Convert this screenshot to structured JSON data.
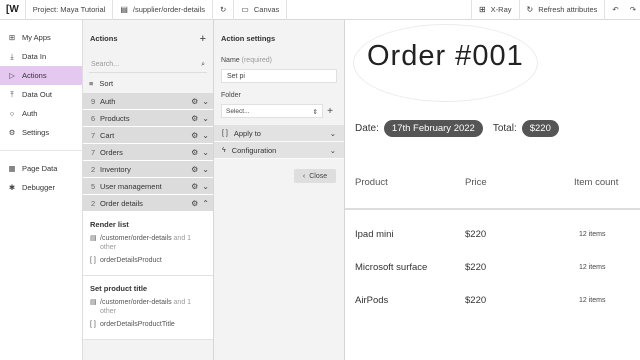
{
  "topbar": {
    "logo": "[W",
    "project": "Project: Maya Tutorial",
    "path": "/supplier/order-details",
    "refresh_icon": "refresh-icon",
    "canvas": "Canvas",
    "xray": "X-Ray",
    "refresh_attributes": "Refresh attributes"
  },
  "nav": {
    "items": [
      {
        "label": "My Apps",
        "icon": "apps-icon"
      },
      {
        "label": "Data In",
        "icon": "download-icon"
      },
      {
        "label": "Actions",
        "icon": "play-icon"
      },
      {
        "label": "Data Out",
        "icon": "upload-icon"
      },
      {
        "label": "Auth",
        "icon": "lock-icon"
      },
      {
        "label": "Settings",
        "icon": "gear-icon"
      }
    ],
    "bottom": [
      {
        "label": "Page Data",
        "icon": "table-icon"
      },
      {
        "label": "Debugger",
        "icon": "bug-icon"
      }
    ]
  },
  "actions": {
    "title": "Actions",
    "search_placeholder": "Search...",
    "sort": "Sort",
    "groups": [
      {
        "count": "9",
        "label": "Auth"
      },
      {
        "count": "6",
        "label": "Products"
      },
      {
        "count": "7",
        "label": "Cart"
      },
      {
        "count": "7",
        "label": "Orders"
      },
      {
        "count": "2",
        "label": "Inventory"
      },
      {
        "count": "5",
        "label": "User management"
      },
      {
        "count": "2",
        "label": "Order details"
      }
    ],
    "subs": [
      {
        "title": "Render list",
        "path": "/customer/order-details",
        "and": " and 1 other",
        "target": "orderDetailsProduct"
      },
      {
        "title": "Set product title",
        "path": "/customer/order-details",
        "and": " and 1 other",
        "target": "orderDetailsProductTitle"
      }
    ]
  },
  "settings": {
    "title": "Action settings",
    "name_label": "Name",
    "name_required": "(required)",
    "name_value": "Set pi",
    "folder_label": "Folder",
    "folder_select": "Select...",
    "apply_to": "Apply to",
    "configuration": "Configuration",
    "close": "Close"
  },
  "canvas": {
    "order_title": "Order #001",
    "date_label": "Date:",
    "date_value": "17th February 2022",
    "total_label": "Total:",
    "total_value": "$220",
    "headers": [
      "Product",
      "Price",
      "Item count"
    ],
    "rows": [
      {
        "product": "Ipad mini",
        "price": "$220",
        "count": "12 items"
      },
      {
        "product": "Microsoft surface",
        "price": "$220",
        "count": "12 items"
      },
      {
        "product": "AirPods",
        "price": "$220",
        "count": "12 items"
      }
    ]
  },
  "colors": {
    "active_nav": "#e5c8ef",
    "pill": "#555555",
    "panel_bg": "#f3f3f3",
    "group_bg": "#dcdcdc"
  }
}
